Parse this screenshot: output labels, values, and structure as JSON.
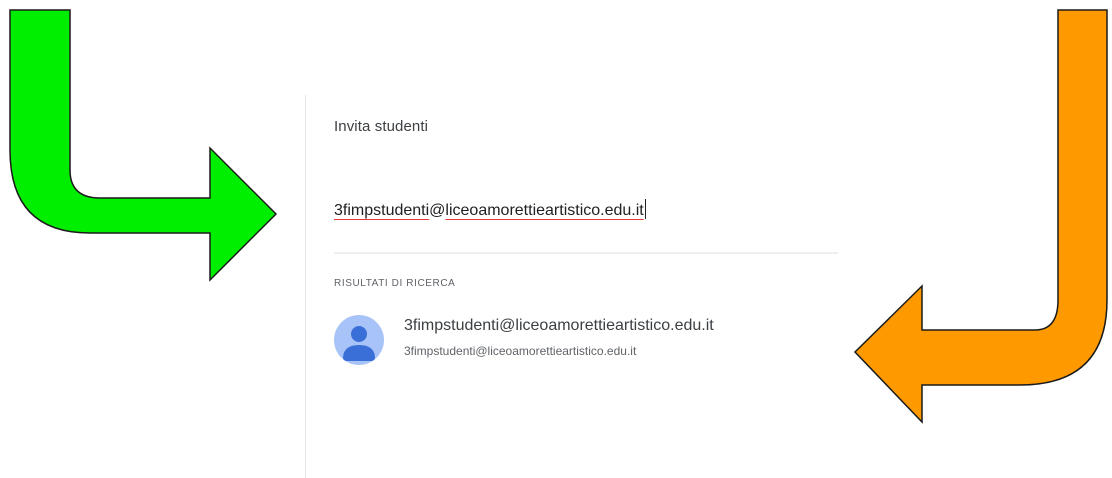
{
  "dialog": {
    "title": "Invita studenti",
    "input": {
      "value": "3fimpstudenti@liceoamorettieartistico.edu.it",
      "value_part1": "3fimpstudenti",
      "value_part2": "@",
      "value_part3": "liceoamorettieartistico.edu.it"
    },
    "results_header": "RISULTATI DI RICERCA",
    "results": [
      {
        "name": "3fimpstudenti@liceoamorettieartistico.edu.it",
        "email": "3fimpstudenti@liceoamorettieartistico.edu.it",
        "avatar_icon": "person-icon"
      }
    ]
  },
  "annotations": {
    "left_arrow_color": "#00ee00",
    "right_arrow_color": "#ff9900"
  },
  "colors": {
    "spellcheck_underline": "#e53935",
    "avatar_bg": "#a8c3f7",
    "avatar_fg": "#3b6fd8"
  }
}
